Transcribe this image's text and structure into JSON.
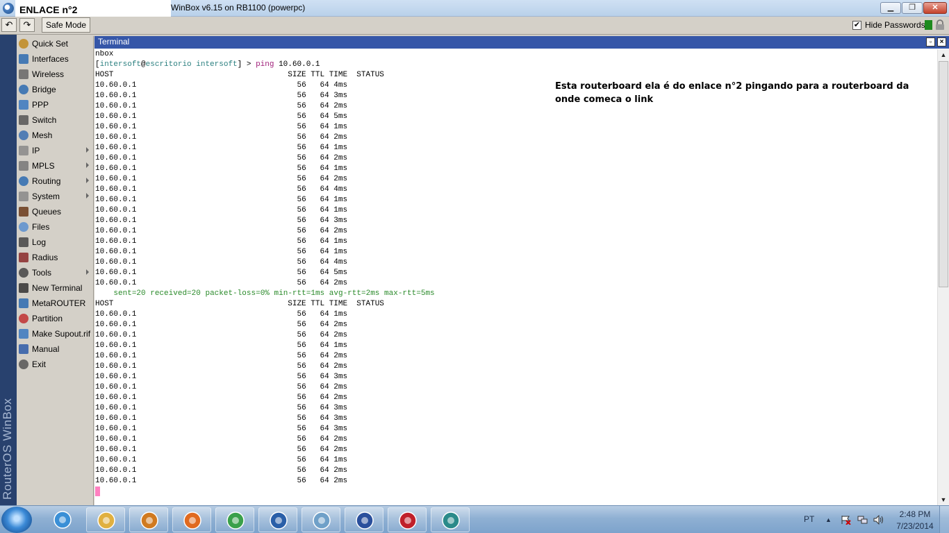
{
  "window": {
    "overlay_label": "ENLACE n°2",
    "title": "WinBox v6.15 on RB1100 (powerpc)"
  },
  "toolbar": {
    "safe_mode": "Safe Mode",
    "hide_passwords": "Hide Passwords",
    "hide_passwords_checked": true
  },
  "brand": "RouterOS WinBox",
  "menu": [
    {
      "label": "Quick Set",
      "icon": "quick-set-icon",
      "submenu": false
    },
    {
      "label": "Interfaces",
      "icon": "interfaces-icon",
      "submenu": false
    },
    {
      "label": "Wireless",
      "icon": "wireless-icon",
      "submenu": false
    },
    {
      "label": "Bridge",
      "icon": "bridge-icon",
      "submenu": false
    },
    {
      "label": "PPP",
      "icon": "ppp-icon",
      "submenu": false
    },
    {
      "label": "Switch",
      "icon": "switch-icon",
      "submenu": false
    },
    {
      "label": "Mesh",
      "icon": "mesh-icon",
      "submenu": false
    },
    {
      "label": "IP",
      "icon": "ip-icon",
      "submenu": true
    },
    {
      "label": "MPLS",
      "icon": "mpls-icon",
      "submenu": true
    },
    {
      "label": "Routing",
      "icon": "routing-icon",
      "submenu": true
    },
    {
      "label": "System",
      "icon": "system-icon",
      "submenu": true
    },
    {
      "label": "Queues",
      "icon": "queues-icon",
      "submenu": false
    },
    {
      "label": "Files",
      "icon": "files-icon",
      "submenu": false
    },
    {
      "label": "Log",
      "icon": "log-icon",
      "submenu": false
    },
    {
      "label": "Radius",
      "icon": "radius-icon",
      "submenu": false
    },
    {
      "label": "Tools",
      "icon": "tools-icon",
      "submenu": true
    },
    {
      "label": "New Terminal",
      "icon": "new-terminal-icon",
      "submenu": false
    },
    {
      "label": "MetaROUTER",
      "icon": "metarouter-icon",
      "submenu": false
    },
    {
      "label": "Partition",
      "icon": "partition-icon",
      "submenu": false
    },
    {
      "label": "Make Supout.rif",
      "icon": "make-supout-icon",
      "submenu": false
    },
    {
      "label": "Manual",
      "icon": "manual-icon",
      "submenu": false
    },
    {
      "label": "Exit",
      "icon": "exit-icon",
      "submenu": false
    }
  ],
  "terminal": {
    "title": "Terminal",
    "first_line": "nbox",
    "prompt": {
      "open": "[",
      "user": "intersoft",
      "at": "@",
      "host": "escritorio intersoft",
      "close": "] > ",
      "command": "ping",
      "arg": " 10.60.0.1"
    },
    "header": {
      "host": "HOST",
      "size": "SIZE",
      "ttl": "TTL",
      "time": "TIME",
      "status": "STATUS"
    },
    "block1": [
      {
        "host": "10.60.0.1",
        "size": "56",
        "ttl": "64",
        "time": "4ms"
      },
      {
        "host": "10.60.0.1",
        "size": "56",
        "ttl": "64",
        "time": "3ms"
      },
      {
        "host": "10.60.0.1",
        "size": "56",
        "ttl": "64",
        "time": "2ms"
      },
      {
        "host": "10.60.0.1",
        "size": "56",
        "ttl": "64",
        "time": "5ms"
      },
      {
        "host": "10.60.0.1",
        "size": "56",
        "ttl": "64",
        "time": "1ms"
      },
      {
        "host": "10.60.0.1",
        "size": "56",
        "ttl": "64",
        "time": "2ms"
      },
      {
        "host": "10.60.0.1",
        "size": "56",
        "ttl": "64",
        "time": "1ms"
      },
      {
        "host": "10.60.0.1",
        "size": "56",
        "ttl": "64",
        "time": "2ms"
      },
      {
        "host": "10.60.0.1",
        "size": "56",
        "ttl": "64",
        "time": "1ms"
      },
      {
        "host": "10.60.0.1",
        "size": "56",
        "ttl": "64",
        "time": "2ms"
      },
      {
        "host": "10.60.0.1",
        "size": "56",
        "ttl": "64",
        "time": "4ms"
      },
      {
        "host": "10.60.0.1",
        "size": "56",
        "ttl": "64",
        "time": "1ms"
      },
      {
        "host": "10.60.0.1",
        "size": "56",
        "ttl": "64",
        "time": "1ms"
      },
      {
        "host": "10.60.0.1",
        "size": "56",
        "ttl": "64",
        "time": "3ms"
      },
      {
        "host": "10.60.0.1",
        "size": "56",
        "ttl": "64",
        "time": "2ms"
      },
      {
        "host": "10.60.0.1",
        "size": "56",
        "ttl": "64",
        "time": "1ms"
      },
      {
        "host": "10.60.0.1",
        "size": "56",
        "ttl": "64",
        "time": "1ms"
      },
      {
        "host": "10.60.0.1",
        "size": "56",
        "ttl": "64",
        "time": "4ms"
      },
      {
        "host": "10.60.0.1",
        "size": "56",
        "ttl": "64",
        "time": "5ms"
      },
      {
        "host": "10.60.0.1",
        "size": "56",
        "ttl": "64",
        "time": "2ms"
      }
    ],
    "stats": [
      {
        "key": "sent",
        "value": "20"
      },
      {
        "key": "received",
        "value": "20"
      },
      {
        "key": "packet-loss",
        "value": "0%"
      },
      {
        "key": "min-rtt",
        "value": "1ms"
      },
      {
        "key": "avg-rtt",
        "value": "2ms"
      },
      {
        "key": "max-rtt",
        "value": "5ms"
      }
    ],
    "block2": [
      {
        "host": "10.60.0.1",
        "size": "56",
        "ttl": "64",
        "time": "1ms"
      },
      {
        "host": "10.60.0.1",
        "size": "56",
        "ttl": "64",
        "time": "2ms"
      },
      {
        "host": "10.60.0.1",
        "size": "56",
        "ttl": "64",
        "time": "2ms"
      },
      {
        "host": "10.60.0.1",
        "size": "56",
        "ttl": "64",
        "time": "1ms"
      },
      {
        "host": "10.60.0.1",
        "size": "56",
        "ttl": "64",
        "time": "2ms"
      },
      {
        "host": "10.60.0.1",
        "size": "56",
        "ttl": "64",
        "time": "2ms"
      },
      {
        "host": "10.60.0.1",
        "size": "56",
        "ttl": "64",
        "time": "3ms"
      },
      {
        "host": "10.60.0.1",
        "size": "56",
        "ttl": "64",
        "time": "2ms"
      },
      {
        "host": "10.60.0.1",
        "size": "56",
        "ttl": "64",
        "time": "2ms"
      },
      {
        "host": "10.60.0.1",
        "size": "56",
        "ttl": "64",
        "time": "3ms"
      },
      {
        "host": "10.60.0.1",
        "size": "56",
        "ttl": "64",
        "time": "3ms"
      },
      {
        "host": "10.60.0.1",
        "size": "56",
        "ttl": "64",
        "time": "3ms"
      },
      {
        "host": "10.60.0.1",
        "size": "56",
        "ttl": "64",
        "time": "2ms"
      },
      {
        "host": "10.60.0.1",
        "size": "56",
        "ttl": "64",
        "time": "2ms"
      },
      {
        "host": "10.60.0.1",
        "size": "56",
        "ttl": "64",
        "time": "1ms"
      },
      {
        "host": "10.60.0.1",
        "size": "56",
        "ttl": "64",
        "time": "2ms"
      },
      {
        "host": "10.60.0.1",
        "size": "56",
        "ttl": "64",
        "time": "2ms"
      }
    ],
    "note": "Esta routerboard ela é do enlace n°2 pingando para a routerboard da onde comeca o link"
  },
  "taskbar": {
    "apps": [
      "internet-explorer-icon",
      "file-explorer-icon",
      "media-player-icon",
      "firefox-icon",
      "chrome-icon",
      "network-app-icon",
      "notepad-icon",
      "remote-tool-icon",
      "opera-icon",
      "winbox-icon"
    ],
    "lang": "PT",
    "time": "2:48 PM",
    "date": "7/23/2014"
  },
  "colors": {
    "terminal_header": "#3556a8",
    "brand_strip": "#28416e",
    "prompt_user": "#2a7f7f",
    "command": "#a0207a",
    "stats": "#2a8a2a",
    "cursor": "#ff80c0"
  }
}
